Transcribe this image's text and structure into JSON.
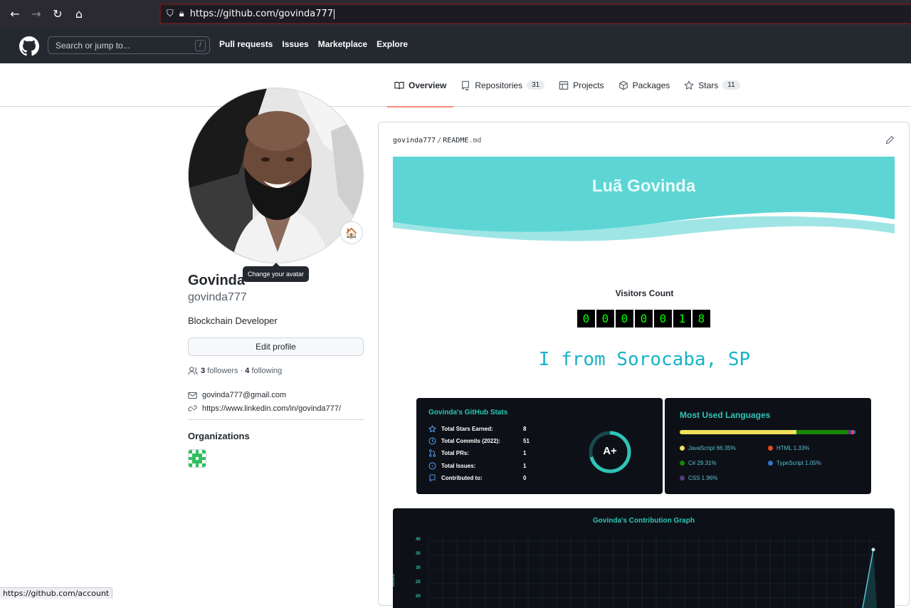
{
  "browser": {
    "url": "https://github.com/govinda777",
    "status_url": "https://github.com/account"
  },
  "header": {
    "search_placeholder": "Search or jump to...",
    "search_shortcut": "/",
    "nav": [
      "Pull requests",
      "Issues",
      "Marketplace",
      "Explore"
    ]
  },
  "tabs": [
    {
      "label": "Overview",
      "icon": "book-icon",
      "selected": true
    },
    {
      "label": "Repositories",
      "icon": "repo-icon",
      "count": "31"
    },
    {
      "label": "Projects",
      "icon": "table-icon"
    },
    {
      "label": "Packages",
      "icon": "package-icon"
    },
    {
      "label": "Stars",
      "icon": "star-icon",
      "count": "11"
    }
  ],
  "profile": {
    "name": "Govinda",
    "login": "govinda777",
    "bio": "Blockchain Developer",
    "edit_label": "Edit profile",
    "avatar_tooltip": "Change your avatar",
    "status_emoji": "🏠",
    "followers_count": "3",
    "followers_label": "followers",
    "following_count": "4",
    "following_label": "following",
    "email": "govinda777@gmail.com",
    "website": "https://www.linkedin.com/in/govinda777/",
    "organizations_title": "Organizations"
  },
  "readme": {
    "owner": "govinda777",
    "file": "README",
    "ext": ".md",
    "banner_title": "Luã Govinda",
    "visitors_title": "Visitors Count",
    "visitor_digits": [
      "0",
      "0",
      "0",
      "0",
      "0",
      "1",
      "8"
    ],
    "location_text": "I from Sorocaba, SP",
    "accent_color": "#5dd5d5"
  },
  "stats_card": {
    "title": "Govinda's GitHub Stats",
    "rows": [
      {
        "label": "Total Stars Earned:",
        "value": "8",
        "icon": "star-icon"
      },
      {
        "label": "Total Commits (2022):",
        "value": "51",
        "icon": "clock-icon"
      },
      {
        "label": "Total PRs:",
        "value": "1",
        "icon": "pr-icon"
      },
      {
        "label": "Total Issues:",
        "value": "1",
        "icon": "issue-icon"
      },
      {
        "label": "Contributed to:",
        "value": "0",
        "icon": "repo-icon"
      }
    ],
    "grade": "A+"
  },
  "lang_card": {
    "title": "Most Used Languages",
    "languages": [
      {
        "name": "JavaScript 66.35%",
        "color": "#f1e05a",
        "pct": 66.35
      },
      {
        "name": "C# 29.31%",
        "color": "#178600",
        "pct": 29.31
      },
      {
        "name": "CSS 1.96%",
        "color": "#563d7c",
        "pct": 1.96
      },
      {
        "name": "HTML 1.33%",
        "color": "#e34c26",
        "pct": 1.33
      },
      {
        "name": "TypeScript 1.05%",
        "color": "#3178c6",
        "pct": 1.05
      }
    ]
  },
  "contribution": {
    "title": "Govinda's Contribution Graph",
    "y_ticks": [
      "40",
      "35",
      "30",
      "25",
      "20"
    ],
    "ylabel": "utions"
  }
}
